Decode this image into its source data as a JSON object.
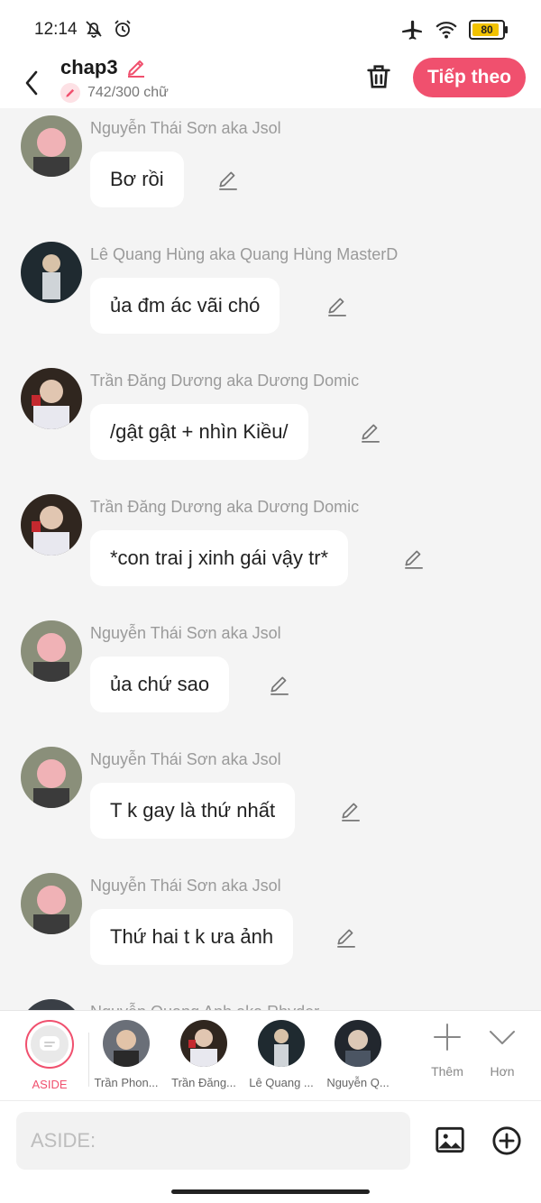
{
  "status_bar": {
    "time": "12:14",
    "battery": "80"
  },
  "header": {
    "title": "chap3",
    "word_count": "742/300 chữ",
    "next_label": "Tiếp theo"
  },
  "messages": [
    {
      "sender": "Nguyễn Thái Sơn aka Jsol",
      "text": "Bơ rồi"
    },
    {
      "sender": "Lê Quang Hùng aka Quang Hùng MasterD",
      "text": "ủa đm ác vãi chó"
    },
    {
      "sender": "Trần Đăng Dương aka Dương Domic",
      "text": "/gật gật + nhìn Kiều/"
    },
    {
      "sender": "Trần Đăng Dương aka Dương Domic",
      "text": "*con trai j xinh gái vậy tr*"
    },
    {
      "sender": "Nguyễn Thái Sơn aka Jsol",
      "text": "ủa chứ sao"
    },
    {
      "sender": "Nguyễn Thái Sơn aka Jsol",
      "text": "T k gay là thứ nhất"
    },
    {
      "sender": "Nguyễn Thái Sơn aka Jsol",
      "text": "Thứ hai t k ưa ảnh"
    },
    {
      "sender": "Nguyễn Quang Anh aka Rhyder",
      "text": ""
    }
  ],
  "characters": [
    {
      "name": "ASIDE"
    },
    {
      "name": "Trần Phon..."
    },
    {
      "name": "Trần Đăng..."
    },
    {
      "name": "Lê Quang ..."
    },
    {
      "name": "Nguyễn Q..."
    }
  ],
  "bar_actions": {
    "more_label": "Thêm",
    "collapse_label": "Hơn"
  },
  "input": {
    "placeholder": "ASIDE:"
  },
  "colors": {
    "accent": "#f0506e",
    "background": "#f4f4f4"
  }
}
